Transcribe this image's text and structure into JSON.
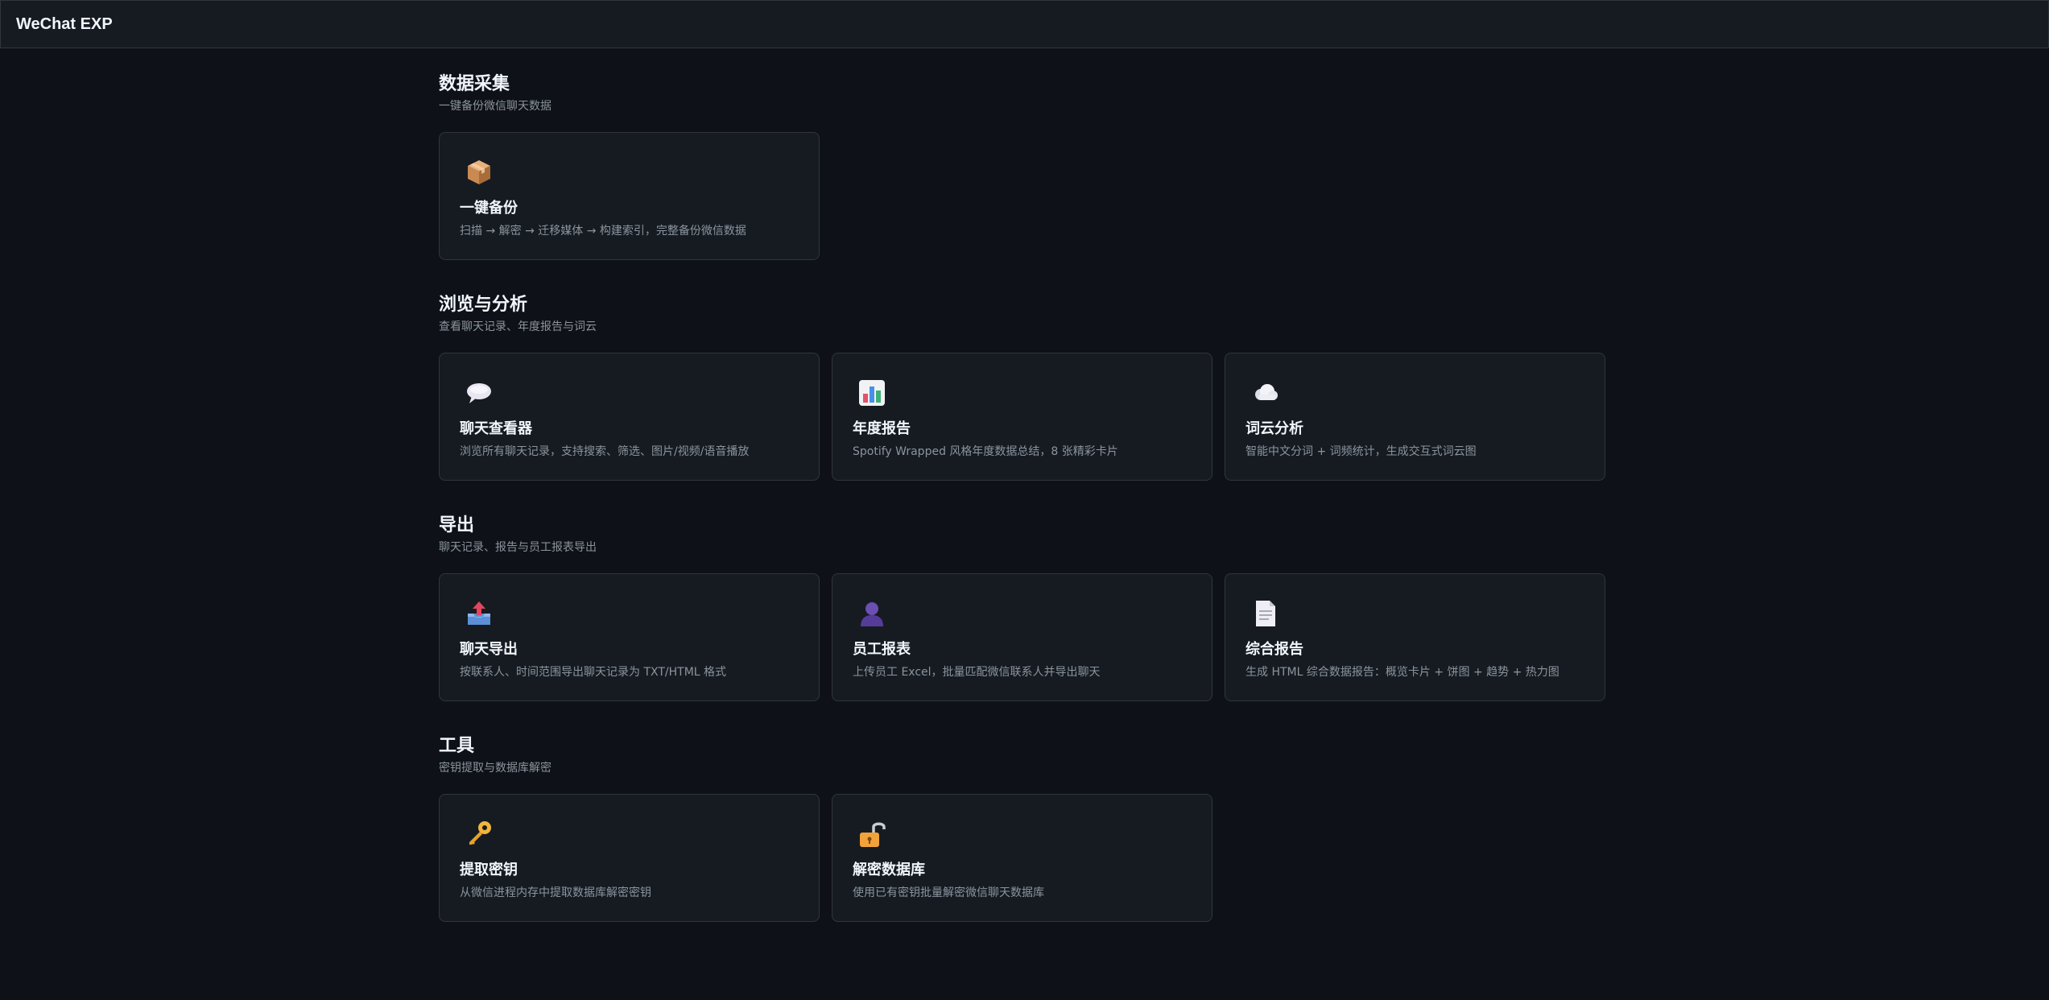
{
  "app": {
    "title": "WeChat EXP"
  },
  "sections": [
    {
      "title": "数据采集",
      "subtitle": "一键备份微信聊天数据",
      "cards": [
        {
          "icon": "package-icon",
          "title": "一键备份",
          "desc": "扫描 → 解密 → 迁移媒体 → 构建索引，完整备份微信数据"
        }
      ]
    },
    {
      "title": "浏览与分析",
      "subtitle": "查看聊天记录、年度报告与词云",
      "cards": [
        {
          "icon": "speech-bubble-icon",
          "title": "聊天查看器",
          "desc": "浏览所有聊天记录，支持搜索、筛选、图片/视频/语音播放"
        },
        {
          "icon": "bar-chart-icon",
          "title": "年度报告",
          "desc": "Spotify Wrapped 风格年度数据总结，8 张精彩卡片"
        },
        {
          "icon": "cloud-icon",
          "title": "词云分析",
          "desc": "智能中文分词 + 词频统计，生成交互式词云图"
        }
      ]
    },
    {
      "title": "导出",
      "subtitle": "聊天记录、报告与员工报表导出",
      "cards": [
        {
          "icon": "outbox-tray-icon",
          "title": "聊天导出",
          "desc": "按联系人、时间范围导出聊天记录为 TXT/HTML 格式"
        },
        {
          "icon": "person-silhouette-icon",
          "title": "员工报表",
          "desc": "上传员工 Excel，批量匹配微信联系人并导出聊天"
        },
        {
          "icon": "document-icon",
          "title": "综合报告",
          "desc": "生成 HTML 综合数据报告：概览卡片 + 饼图 + 趋势 + 热力图"
        }
      ]
    },
    {
      "title": "工具",
      "subtitle": "密钥提取与数据库解密",
      "cards": [
        {
          "icon": "key-icon",
          "title": "提取密钥",
          "desc": "从微信进程内存中提取数据库解密密钥"
        },
        {
          "icon": "unlocked-padlock-icon",
          "title": "解密数据库",
          "desc": "使用已有密钥批量解密微信聊天数据库"
        }
      ]
    }
  ]
}
